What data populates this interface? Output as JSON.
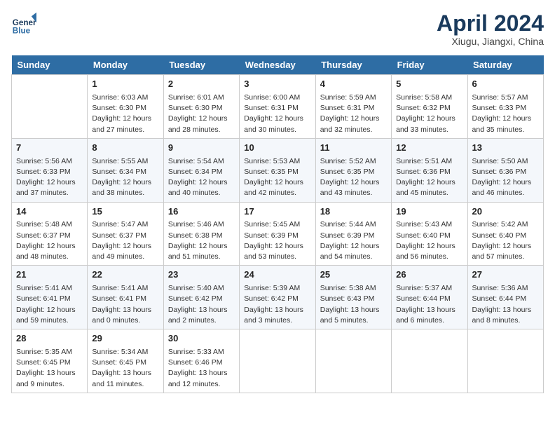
{
  "header": {
    "logo_general": "General",
    "logo_blue": "Blue",
    "month_title": "April 2024",
    "location": "Xiugu, Jiangxi, China"
  },
  "weekdays": [
    "Sunday",
    "Monday",
    "Tuesday",
    "Wednesday",
    "Thursday",
    "Friday",
    "Saturday"
  ],
  "weeks": [
    [
      {
        "day": "",
        "info": ""
      },
      {
        "day": "1",
        "info": "Sunrise: 6:03 AM\nSunset: 6:30 PM\nDaylight: 12 hours\nand 27 minutes."
      },
      {
        "day": "2",
        "info": "Sunrise: 6:01 AM\nSunset: 6:30 PM\nDaylight: 12 hours\nand 28 minutes."
      },
      {
        "day": "3",
        "info": "Sunrise: 6:00 AM\nSunset: 6:31 PM\nDaylight: 12 hours\nand 30 minutes."
      },
      {
        "day": "4",
        "info": "Sunrise: 5:59 AM\nSunset: 6:31 PM\nDaylight: 12 hours\nand 32 minutes."
      },
      {
        "day": "5",
        "info": "Sunrise: 5:58 AM\nSunset: 6:32 PM\nDaylight: 12 hours\nand 33 minutes."
      },
      {
        "day": "6",
        "info": "Sunrise: 5:57 AM\nSunset: 6:33 PM\nDaylight: 12 hours\nand 35 minutes."
      }
    ],
    [
      {
        "day": "7",
        "info": "Sunrise: 5:56 AM\nSunset: 6:33 PM\nDaylight: 12 hours\nand 37 minutes."
      },
      {
        "day": "8",
        "info": "Sunrise: 5:55 AM\nSunset: 6:34 PM\nDaylight: 12 hours\nand 38 minutes."
      },
      {
        "day": "9",
        "info": "Sunrise: 5:54 AM\nSunset: 6:34 PM\nDaylight: 12 hours\nand 40 minutes."
      },
      {
        "day": "10",
        "info": "Sunrise: 5:53 AM\nSunset: 6:35 PM\nDaylight: 12 hours\nand 42 minutes."
      },
      {
        "day": "11",
        "info": "Sunrise: 5:52 AM\nSunset: 6:35 PM\nDaylight: 12 hours\nand 43 minutes."
      },
      {
        "day": "12",
        "info": "Sunrise: 5:51 AM\nSunset: 6:36 PM\nDaylight: 12 hours\nand 45 minutes."
      },
      {
        "day": "13",
        "info": "Sunrise: 5:50 AM\nSunset: 6:36 PM\nDaylight: 12 hours\nand 46 minutes."
      }
    ],
    [
      {
        "day": "14",
        "info": "Sunrise: 5:48 AM\nSunset: 6:37 PM\nDaylight: 12 hours\nand 48 minutes."
      },
      {
        "day": "15",
        "info": "Sunrise: 5:47 AM\nSunset: 6:37 PM\nDaylight: 12 hours\nand 49 minutes."
      },
      {
        "day": "16",
        "info": "Sunrise: 5:46 AM\nSunset: 6:38 PM\nDaylight: 12 hours\nand 51 minutes."
      },
      {
        "day": "17",
        "info": "Sunrise: 5:45 AM\nSunset: 6:39 PM\nDaylight: 12 hours\nand 53 minutes."
      },
      {
        "day": "18",
        "info": "Sunrise: 5:44 AM\nSunset: 6:39 PM\nDaylight: 12 hours\nand 54 minutes."
      },
      {
        "day": "19",
        "info": "Sunrise: 5:43 AM\nSunset: 6:40 PM\nDaylight: 12 hours\nand 56 minutes."
      },
      {
        "day": "20",
        "info": "Sunrise: 5:42 AM\nSunset: 6:40 PM\nDaylight: 12 hours\nand 57 minutes."
      }
    ],
    [
      {
        "day": "21",
        "info": "Sunrise: 5:41 AM\nSunset: 6:41 PM\nDaylight: 12 hours\nand 59 minutes."
      },
      {
        "day": "22",
        "info": "Sunrise: 5:41 AM\nSunset: 6:41 PM\nDaylight: 13 hours\nand 0 minutes."
      },
      {
        "day": "23",
        "info": "Sunrise: 5:40 AM\nSunset: 6:42 PM\nDaylight: 13 hours\nand 2 minutes."
      },
      {
        "day": "24",
        "info": "Sunrise: 5:39 AM\nSunset: 6:42 PM\nDaylight: 13 hours\nand 3 minutes."
      },
      {
        "day": "25",
        "info": "Sunrise: 5:38 AM\nSunset: 6:43 PM\nDaylight: 13 hours\nand 5 minutes."
      },
      {
        "day": "26",
        "info": "Sunrise: 5:37 AM\nSunset: 6:44 PM\nDaylight: 13 hours\nand 6 minutes."
      },
      {
        "day": "27",
        "info": "Sunrise: 5:36 AM\nSunset: 6:44 PM\nDaylight: 13 hours\nand 8 minutes."
      }
    ],
    [
      {
        "day": "28",
        "info": "Sunrise: 5:35 AM\nSunset: 6:45 PM\nDaylight: 13 hours\nand 9 minutes."
      },
      {
        "day": "29",
        "info": "Sunrise: 5:34 AM\nSunset: 6:45 PM\nDaylight: 13 hours\nand 11 minutes."
      },
      {
        "day": "30",
        "info": "Sunrise: 5:33 AM\nSunset: 6:46 PM\nDaylight: 13 hours\nand 12 minutes."
      },
      {
        "day": "",
        "info": ""
      },
      {
        "day": "",
        "info": ""
      },
      {
        "day": "",
        "info": ""
      },
      {
        "day": "",
        "info": ""
      }
    ]
  ]
}
